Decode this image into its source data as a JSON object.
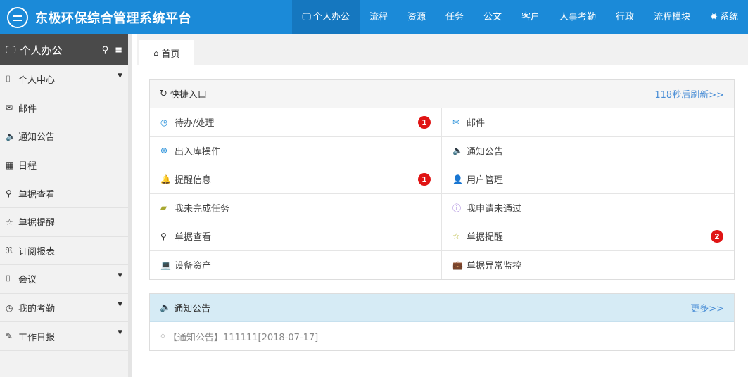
{
  "app": {
    "title": "东极环保综合管理系统平台"
  },
  "nav": [
    {
      "label": "个人办公",
      "icon": "monitor-icon",
      "glyph": "🖵",
      "active": true
    },
    {
      "label": "流程"
    },
    {
      "label": "资源"
    },
    {
      "label": "任务"
    },
    {
      "label": "公文"
    },
    {
      "label": "客户"
    },
    {
      "label": "人事考勤"
    },
    {
      "label": "行政"
    },
    {
      "label": "流程模块"
    },
    {
      "label": "系统",
      "icon": "gear-icon",
      "glyph": "✹"
    }
  ],
  "sidebar": {
    "title": "个人办公",
    "items": [
      {
        "label": "个人中心",
        "icon": "bookmark-icon",
        "glyph": "⌷",
        "has_caret": true
      },
      {
        "label": "邮件",
        "icon": "envelope-icon",
        "glyph": "✉"
      },
      {
        "label": "通知公告",
        "icon": "speaker-icon",
        "glyph": "🔈"
      },
      {
        "label": "日程",
        "icon": "calendar-icon",
        "glyph": "▦"
      },
      {
        "label": "单据查看",
        "icon": "search-icon",
        "glyph": "⚲"
      },
      {
        "label": "单据提醒",
        "icon": "star-icon",
        "glyph": "☆"
      },
      {
        "label": "订阅报表",
        "icon": "rss-icon",
        "glyph": "ℜ"
      },
      {
        "label": "会议",
        "icon": "bookmark-icon",
        "glyph": "⌷",
        "has_caret": true
      },
      {
        "label": "我的考勤",
        "icon": "clock-icon",
        "glyph": "◷",
        "has_caret": true
      },
      {
        "label": "工作日报",
        "icon": "edit-icon",
        "glyph": "✎",
        "has_caret": true
      }
    ]
  },
  "tabs": [
    {
      "label": "首页",
      "icon": "home-icon",
      "glyph": "⌂"
    }
  ],
  "quick_entry": {
    "title": "快捷入口",
    "refresh_text": "118秒后刷新>>",
    "items": [
      {
        "label": "待办/处理",
        "icon": "clock-icon",
        "glyph": "◷",
        "color": "#1b8ad8",
        "badge": "1"
      },
      {
        "label": "邮件",
        "icon": "envelope-icon",
        "glyph": "✉",
        "color": "#1b8ad8"
      },
      {
        "label": "出入库操作",
        "icon": "plus-circle-icon",
        "glyph": "⊕",
        "color": "#1b8ad8"
      },
      {
        "label": "通知公告",
        "icon": "speaker-icon",
        "glyph": "🔈",
        "color": "#555555"
      },
      {
        "label": "提醒信息",
        "icon": "bell-icon",
        "glyph": "🔔",
        "color": "#e0a030",
        "badge": "1"
      },
      {
        "label": "用户管理",
        "icon": "user-icon",
        "glyph": "👤",
        "color": "#4a8ed6"
      },
      {
        "label": "我未完成任务",
        "icon": "book-icon",
        "glyph": "▰",
        "color": "#a8a830"
      },
      {
        "label": "我申请未通过",
        "icon": "info-icon",
        "glyph": "ⓘ",
        "color": "#8a5fd0"
      },
      {
        "label": "单据查看",
        "icon": "search-icon",
        "glyph": "⚲",
        "color": "#333333"
      },
      {
        "label": "单据提醒",
        "icon": "star-icon",
        "glyph": "☆",
        "color": "#b5b530",
        "badge": "2"
      },
      {
        "label": "设备资产",
        "icon": "laptop-icon",
        "glyph": "💻",
        "color": "#cc2222"
      },
      {
        "label": "单据异常监控",
        "icon": "briefcase-icon",
        "glyph": "💼",
        "color": "#aa2222"
      }
    ]
  },
  "notices": {
    "title": "通知公告",
    "more_text": "更多>>",
    "items": [
      {
        "text": "【通知公告】111111[2018-07-17]"
      }
    ]
  }
}
